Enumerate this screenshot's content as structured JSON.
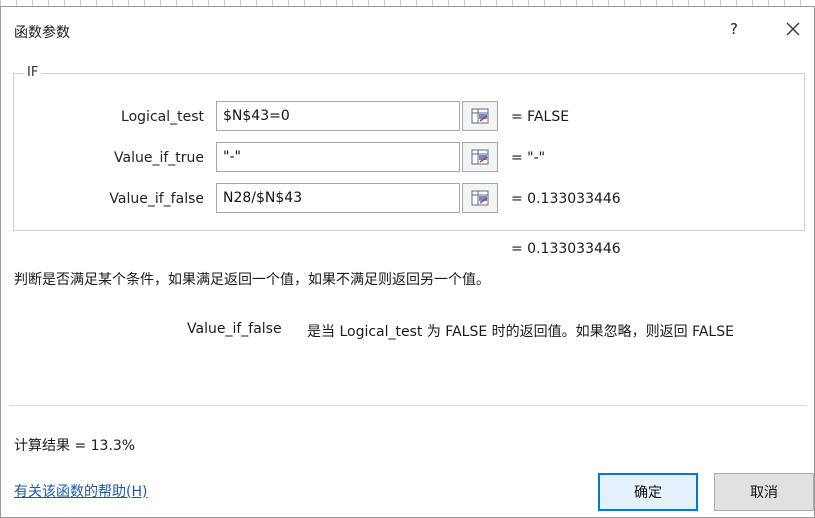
{
  "dialog": {
    "title": "函数参数",
    "help_label": "?",
    "function_name": "IF"
  },
  "arguments": [
    {
      "label": "Logical_test",
      "value": "$N$43=0",
      "result": "=  FALSE"
    },
    {
      "label": "Value_if_true",
      "value": "\"-\"",
      "result": "=  \"-\""
    },
    {
      "label": "Value_if_false",
      "value": "N28/$N$43",
      "result": "=  0.133033446"
    }
  ],
  "formula_result": "=  0.133033446",
  "description": "判断是否满足某个条件，如果满足返回一个值，如果不满足则返回另一个值。",
  "parameter_help": {
    "name": "Value_if_false",
    "text": "是当 Logical_test 为 FALSE 时的返回值。如果忽略，则返回 FALSE"
  },
  "calc_result": "计算结果 =  13.3%",
  "help_link": "有关该函数的帮助(H)",
  "buttons": {
    "ok": "确定",
    "cancel": "取消"
  },
  "icons": {
    "close": "close-icon",
    "ref": "range-selector-icon"
  },
  "colors": {
    "accent": "#0078d7",
    "link": "#1a5aa8"
  }
}
